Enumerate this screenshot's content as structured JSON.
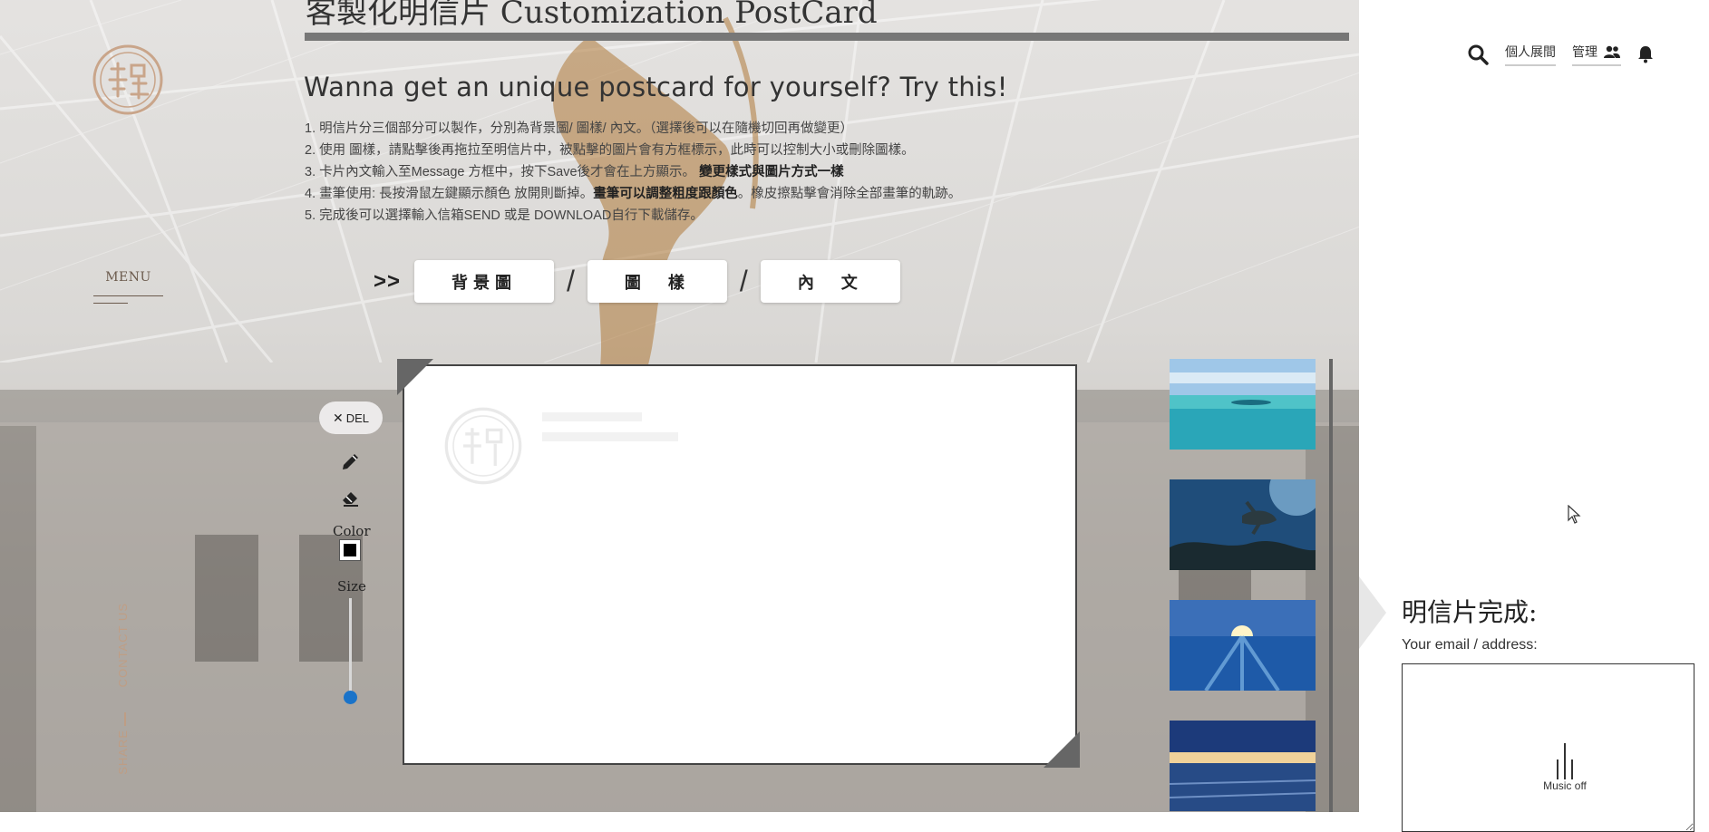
{
  "header": {
    "title": "客製化明信片 Customization PostCard",
    "subtitle": "Wanna get an unique postcard for yourself? Try this!"
  },
  "nav": {
    "menu_label": "MENU",
    "side_share": "SHARE",
    "side_contact": "CONTACT US",
    "topbar": {
      "personal_exhibition": "個人展間",
      "manage": "管理"
    }
  },
  "instructions": [
    {
      "text": "1. 明信片分三個部分可以製作，分別為背景圖/ 圖樣/ 內文。（選擇後可以在隨機切回再做變更）",
      "bold": ""
    },
    {
      "text": "2. 使用 圖樣，請點擊後再拖拉至明信片中，被點擊的圖片會有方框標示，此時可以控制大小或刪除圖樣。",
      "bold": ""
    },
    {
      "text": "3. 卡片內文輸入至Message 方框中，按下Save後才會在上方顯示。",
      "bold": "變更樣式與圖片方式一樣"
    },
    {
      "text": "4. 畫筆使用: 長按滑鼠左鍵顯示顏色 放開則斷掉。",
      "bold": "畫筆可以調整粗度跟顏色",
      "tail": "。橡皮擦點擊會消除全部畫筆的軌跡。"
    },
    {
      "text": "5. 完成後可以選擇輸入信箱SEND 或是 DOWNLOAD自行下載儲存。",
      "bold": ""
    }
  ],
  "tabs": {
    "arrow": ">>",
    "items": [
      "背景圖",
      "圖　樣",
      "內　文"
    ],
    "separator": "/"
  },
  "tools": {
    "delete_label": "DEL",
    "color_label": "Color",
    "color_value": "#000000",
    "size_label": "Size",
    "size_value": 0.05
  },
  "thumbnails": [
    {
      "name": "tropical-shallow-sea"
    },
    {
      "name": "sea-turtle-underwater"
    },
    {
      "name": "ocean-split-sunlight"
    },
    {
      "name": "ocean-sunset-horizon"
    }
  ],
  "completion": {
    "title": "明信片完成:",
    "email_label": "Your email / address:",
    "email_value": ""
  },
  "music": {
    "label": "Music off"
  },
  "colors": {
    "accent_blue": "#1a73c9",
    "title_bar": "#777777",
    "canvas_border": "#444444"
  }
}
